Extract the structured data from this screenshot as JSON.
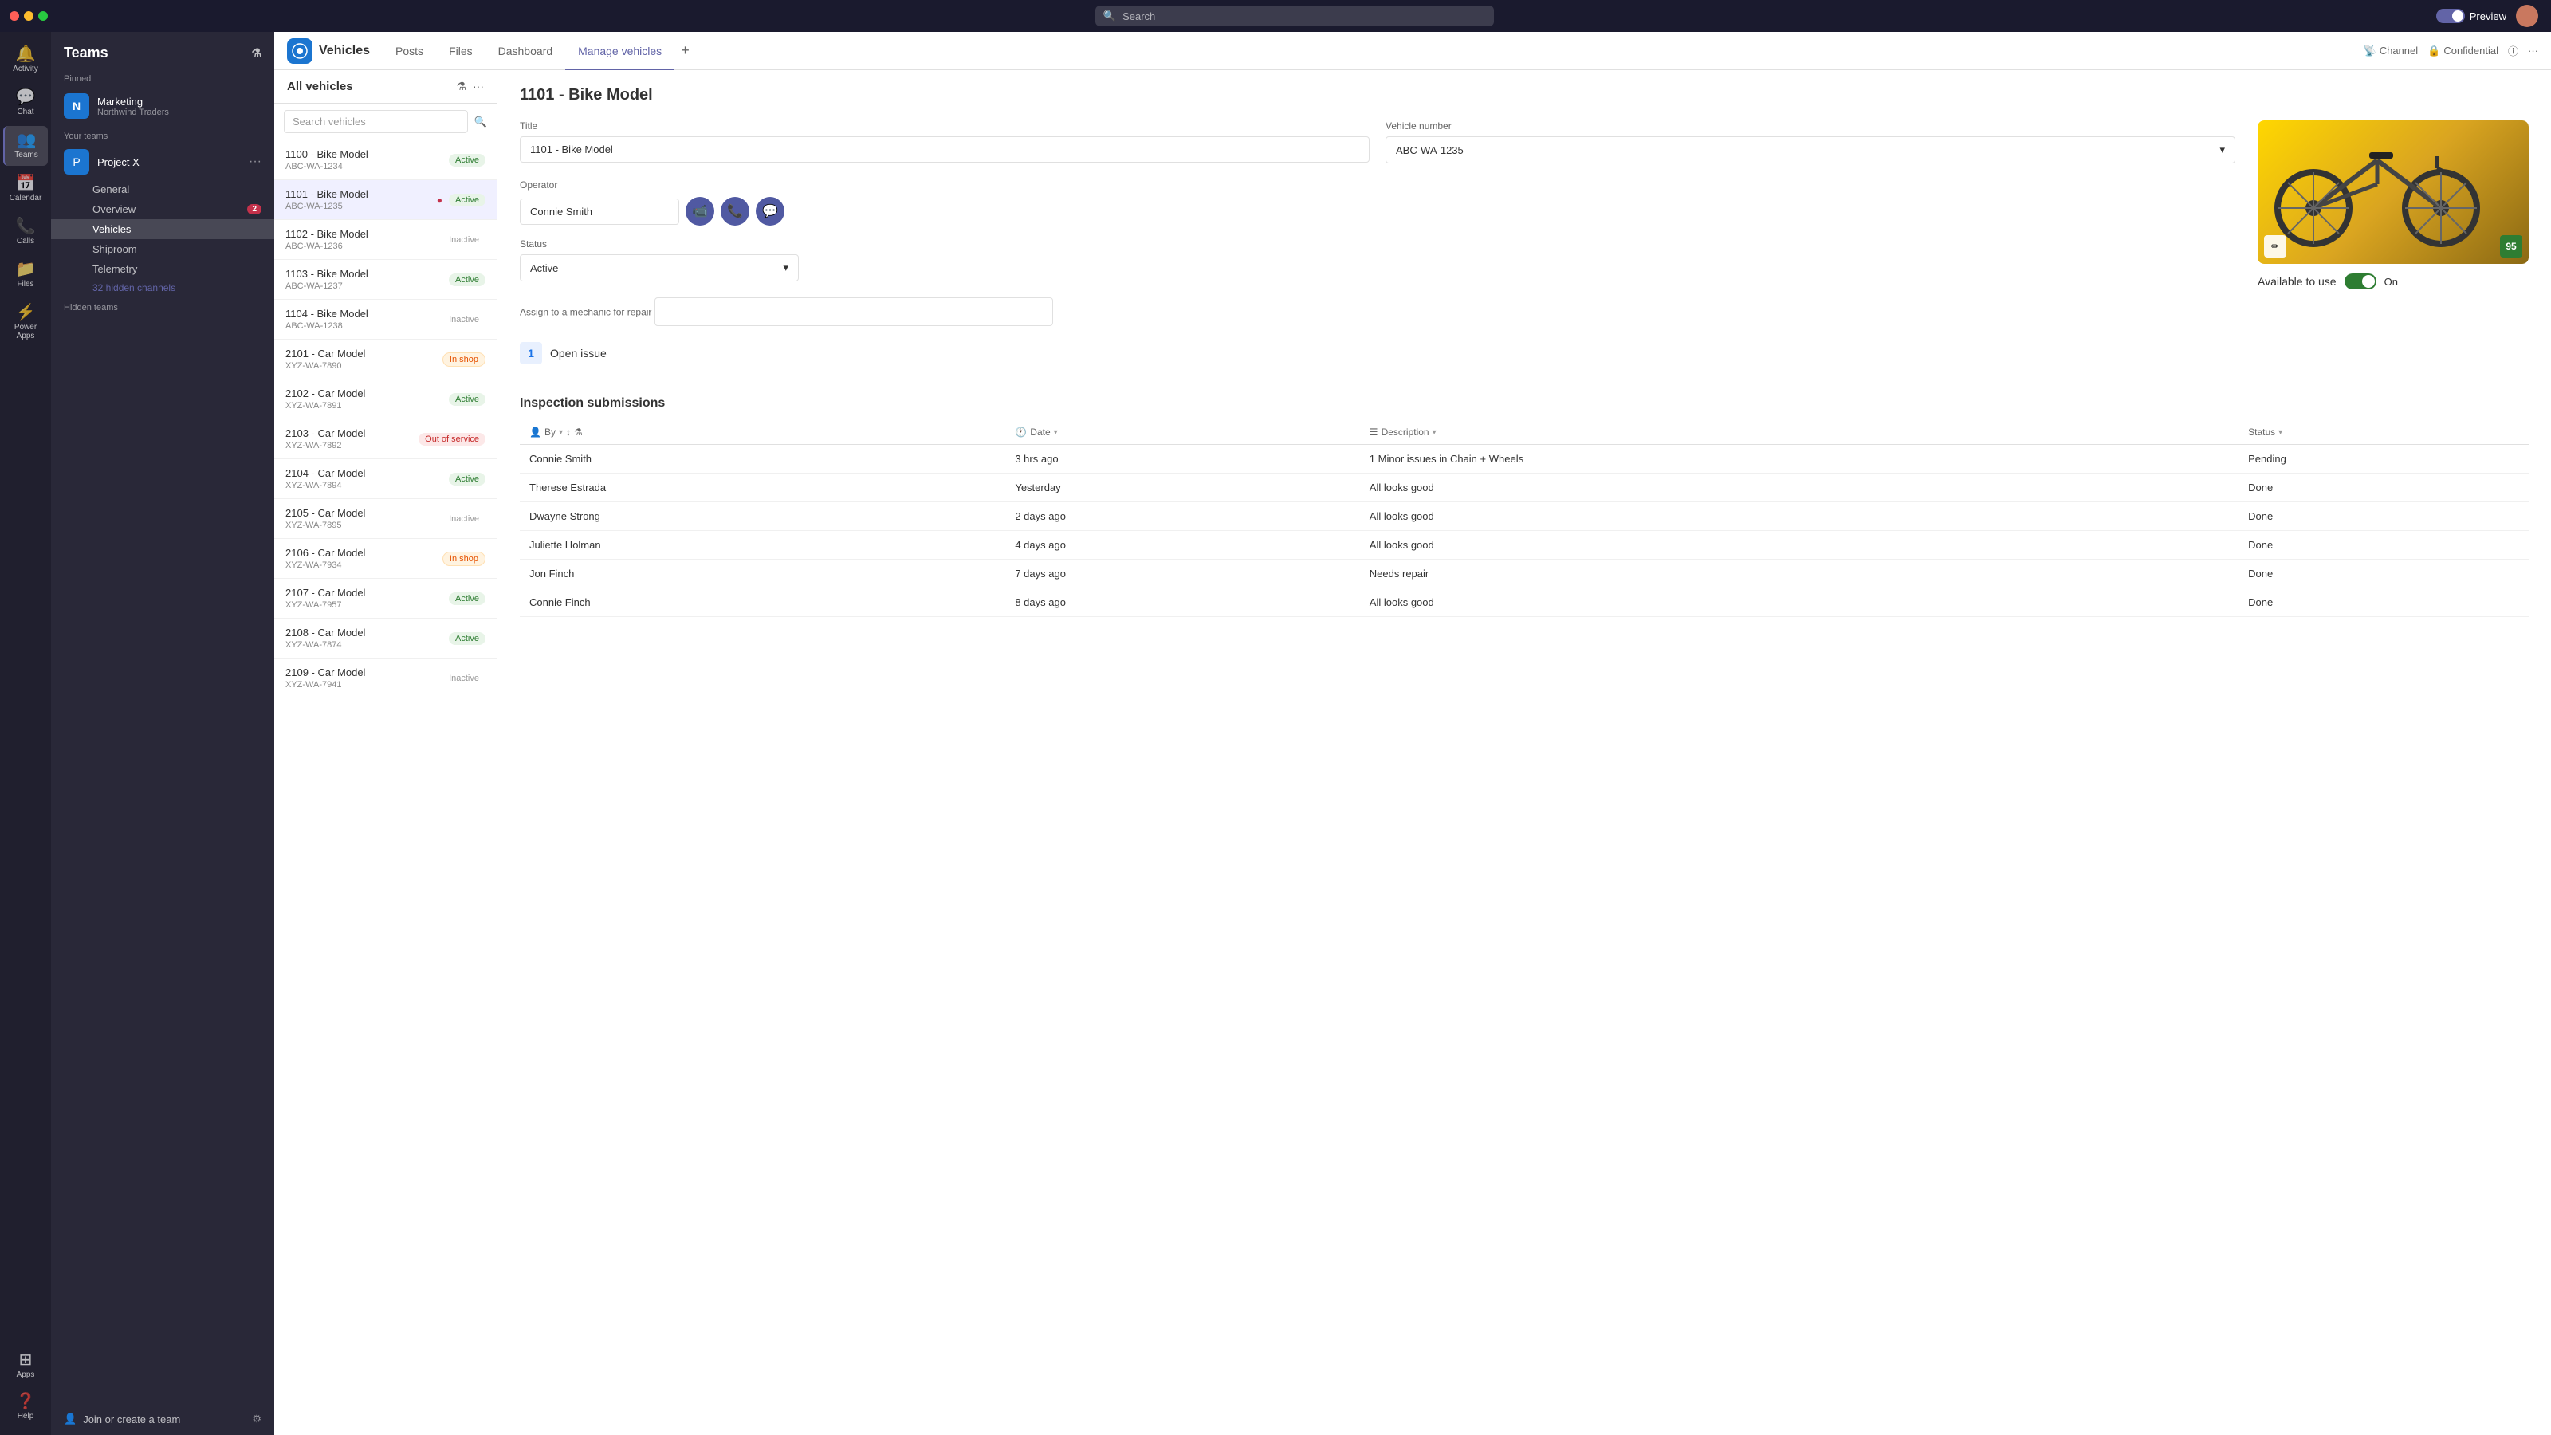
{
  "titleBar": {
    "searchPlaceholder": "Search",
    "previewLabel": "Preview",
    "toggleOn": true
  },
  "iconSidebar": {
    "items": [
      {
        "id": "activity",
        "label": "Activity",
        "icon": "🔔",
        "active": false
      },
      {
        "id": "chat",
        "label": "Chat",
        "icon": "💬",
        "active": false
      },
      {
        "id": "teams",
        "label": "Teams",
        "icon": "👥",
        "active": true
      },
      {
        "id": "calendar",
        "label": "Calendar",
        "icon": "📅",
        "active": false
      },
      {
        "id": "calls",
        "label": "Calls",
        "icon": "📞",
        "active": false
      },
      {
        "id": "files",
        "label": "Files",
        "icon": "📁",
        "active": false
      },
      {
        "id": "powerapps",
        "label": "Power Apps",
        "icon": "⚡",
        "active": false
      },
      {
        "id": "apps",
        "label": "Apps",
        "icon": "⊞",
        "active": false
      },
      {
        "id": "help",
        "label": "Help",
        "icon": "❓",
        "active": false
      }
    ]
  },
  "teamsSidebar": {
    "title": "Teams",
    "pinnedLabel": "Pinned",
    "yourTeamsLabel": "Your teams",
    "hiddenTeamsLabel": "Hidden teams",
    "pinned": [
      {
        "name": "Marketing",
        "sub": "Northwind Traders",
        "avatar": "N"
      }
    ],
    "teams": [
      {
        "name": "Project X",
        "avatar": "P",
        "channels": [
          {
            "name": "General",
            "badge": null
          },
          {
            "name": "Overview",
            "badge": 2
          },
          {
            "name": "Vehicles",
            "badge": null,
            "active": true
          },
          {
            "name": "Shiproom",
            "badge": null,
            "bold": true
          },
          {
            "name": "Telemetry",
            "badge": null
          }
        ],
        "hiddenChannels": "32 hidden channels"
      }
    ],
    "joinTeamLabel": "Join or create a team"
  },
  "tabBar": {
    "appTitle": "Vehicles",
    "tabs": [
      {
        "id": "posts",
        "label": "Posts",
        "active": false
      },
      {
        "id": "files",
        "label": "Files",
        "active": false
      },
      {
        "id": "dashboard",
        "label": "Dashboard",
        "active": false
      },
      {
        "id": "manage",
        "label": "Manage vehicles",
        "active": true
      }
    ],
    "addLabel": "+",
    "channelLabel": "Channel",
    "confidentialLabel": "Confidential"
  },
  "vehicleListPanel": {
    "title": "All vehicles",
    "searchPlaceholder": "Search vehicles",
    "vehicles": [
      {
        "id": "v1100",
        "name": "1100 - Bike Model",
        "code": "ABC-WA-1234",
        "status": "Active",
        "statusType": "active",
        "alert": false
      },
      {
        "id": "v1101",
        "name": "1101 - Bike Model",
        "code": "ABC-WA-1235",
        "status": "Active",
        "statusType": "active",
        "alert": true,
        "selected": true
      },
      {
        "id": "v1102",
        "name": "1102 - Bike Model",
        "code": "ABC-WA-1236",
        "status": "Inactive",
        "statusType": "inactive",
        "alert": false
      },
      {
        "id": "v1103",
        "name": "1103 - Bike Model",
        "code": "ABC-WA-1237",
        "status": "Active",
        "statusType": "active",
        "alert": false
      },
      {
        "id": "v1104",
        "name": "1104 - Bike Model",
        "code": "ABC-WA-1238",
        "status": "Inactive",
        "statusType": "inactive",
        "alert": false
      },
      {
        "id": "v2101",
        "name": "2101 - Car Model",
        "code": "XYZ-WA-7890",
        "status": "In shop",
        "statusType": "inshop",
        "alert": false
      },
      {
        "id": "v2102",
        "name": "2102 - Car Model",
        "code": "XYZ-WA-7891",
        "status": "Active",
        "statusType": "active",
        "alert": false
      },
      {
        "id": "v2103",
        "name": "2103 - Car Model",
        "code": "XYZ-WA-7892",
        "status": "Out of service",
        "statusType": "outofservice",
        "alert": false
      },
      {
        "id": "v2104",
        "name": "2104 - Car Model",
        "code": "XYZ-WA-7894",
        "status": "Active",
        "statusType": "active",
        "alert": false
      },
      {
        "id": "v2105",
        "name": "2105 - Car Model",
        "code": "XYZ-WA-7895",
        "status": "Inactive",
        "statusType": "inactive",
        "alert": false
      },
      {
        "id": "v2106",
        "name": "2106 - Car Model",
        "code": "XYZ-WA-7934",
        "status": "In shop",
        "statusType": "inshop",
        "alert": false
      },
      {
        "id": "v2107",
        "name": "2107 - Car Model",
        "code": "XYZ-WA-7957",
        "status": "Active",
        "statusType": "active",
        "alert": false
      },
      {
        "id": "v2108",
        "name": "2108 - Car Model",
        "code": "XYZ-WA-7874",
        "status": "Active",
        "statusType": "active",
        "alert": false
      },
      {
        "id": "v2109",
        "name": "2109 - Car Model",
        "code": "XYZ-WA-7941",
        "status": "Inactive",
        "statusType": "inactive",
        "alert": false
      }
    ]
  },
  "vehicleDetail": {
    "title": "1101 - Bike Model",
    "fields": {
      "titleLabel": "Title",
      "titleValue": "1101 - Bike Model",
      "vehicleNumberLabel": "Vehicle number",
      "vehicleNumberValue": "ABC-WA-1235",
      "operatorLabel": "Operator",
      "operatorValue": "Connie Smith",
      "statusLabel": "Status",
      "statusValue": "Active",
      "assignLabel": "Assign to a mechanic for repair",
      "assignValue": "",
      "openIssuesCount": "1",
      "openIssuesLabel": "Open issue"
    },
    "availableToUse": {
      "label": "Available to use",
      "toggleOn": true,
      "onLabel": "On"
    },
    "imageScore": "95",
    "operatorButtons": [
      {
        "id": "video",
        "icon": "📹"
      },
      {
        "id": "call",
        "icon": "📞"
      },
      {
        "id": "chat",
        "icon": "💬"
      }
    ],
    "inspectionSection": {
      "title": "Inspection submissions",
      "columns": [
        {
          "id": "by",
          "label": "By",
          "sortable": true
        },
        {
          "id": "date",
          "label": "Date",
          "sortable": true
        },
        {
          "id": "description",
          "label": "Description",
          "sortable": true
        },
        {
          "id": "status",
          "label": "Status",
          "sortable": true
        }
      ],
      "rows": [
        {
          "by": "Connie Smith",
          "date": "3 hrs ago",
          "description": "1 Minor issues in Chain + Wheels",
          "status": "Pending",
          "statusType": "pending"
        },
        {
          "by": "Therese Estrada",
          "date": "Yesterday",
          "description": "All looks good",
          "status": "Done",
          "statusType": "done"
        },
        {
          "by": "Dwayne Strong",
          "date": "2 days ago",
          "description": "All looks good",
          "status": "Done",
          "statusType": "done"
        },
        {
          "by": "Juliette Holman",
          "date": "4 days ago",
          "description": "All looks good",
          "status": "Done",
          "statusType": "done"
        },
        {
          "by": "Jon Finch",
          "date": "7 days ago",
          "description": "Needs repair",
          "status": "Done",
          "statusType": "done"
        },
        {
          "by": "Connie Finch",
          "date": "8 days ago",
          "description": "All looks good",
          "status": "Done",
          "statusType": "done"
        }
      ]
    }
  },
  "icons": {
    "search": "🔍",
    "filter": "⚗",
    "more": "···",
    "chevronDown": "▾",
    "edit": "✏",
    "settings": "⚙",
    "joinTeam": "👤+",
    "channel": "📡",
    "info": "ⓘ"
  }
}
